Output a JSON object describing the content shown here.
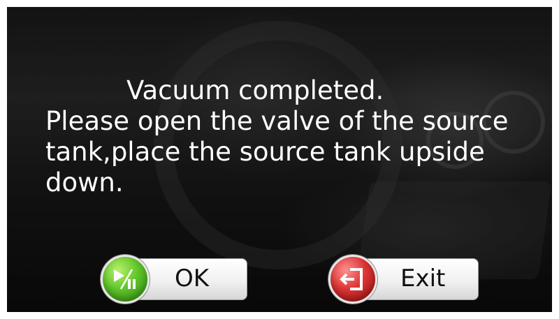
{
  "dialog": {
    "message_lines": [
      "Vacuum completed.",
      "Please open the valve of the source",
      "tank,place the source tank upside",
      "down."
    ]
  },
  "buttons": {
    "ok": {
      "label": "OK",
      "icon": "play-pause-icon",
      "color": "#5fc52a"
    },
    "exit": {
      "label": "Exit",
      "icon": "exit-door-icon",
      "color": "#dd3434"
    }
  }
}
